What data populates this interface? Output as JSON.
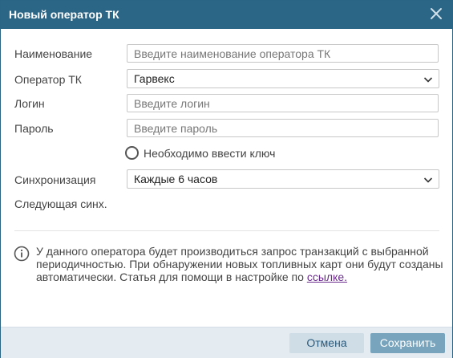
{
  "dialog": {
    "title": "Новый оператор ТК",
    "close_icon": "close-icon"
  },
  "form": {
    "name": {
      "label": "Наименование",
      "placeholder": "Введите наименование оператора ТК",
      "value": ""
    },
    "operator": {
      "label": "Оператор ТК",
      "value": "Гарвекс"
    },
    "login": {
      "label": "Логин",
      "placeholder": "Введите логин",
      "value": ""
    },
    "password": {
      "label": "Пароль",
      "placeholder": "Введите пароль",
      "value": ""
    },
    "key_radio": {
      "label": "Необходимо ввести ключ",
      "checked": false
    },
    "sync": {
      "label": "Синхронизация",
      "value": "Каждые 6 часов"
    },
    "next_sync": {
      "label": "Следующая синх."
    }
  },
  "info": {
    "icon": "info-icon",
    "text": "У данного оператора будет производиться запрос транзакций с выбранной периодичностью. При обнаружении новых топливных карт они будут созданы автоматически. Статья для помощи в настройке по ",
    "link": "ссылке."
  },
  "footer": {
    "cancel_label": "Отмена",
    "save_label": "Сохранить"
  },
  "colors": {
    "titlebar": "#2b6687",
    "footer": "#e4ebf1",
    "save_button": "#78a4bd",
    "cancel_button": "#cfdde7",
    "link": "#6a2b8c"
  }
}
